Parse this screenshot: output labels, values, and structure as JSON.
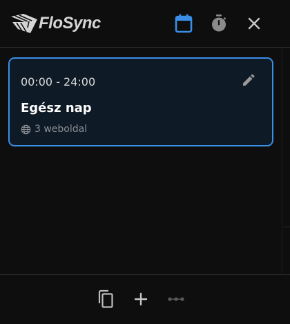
{
  "app": {
    "name": "FloSync"
  },
  "header": {
    "calendar_icon": "calendar-icon",
    "timer_icon": "stopwatch-icon",
    "close_icon": "close-icon"
  },
  "schedule": {
    "items": [
      {
        "time_range": "00:00 - 24:00",
        "title": "Egész nap",
        "sites": "3 weboldal",
        "selected": true
      }
    ]
  },
  "footer": {
    "copy_icon": "copy-icon",
    "add_icon": "plus-icon",
    "more_icon": "more-dots-icon"
  },
  "colors": {
    "accent": "#3a8ee6",
    "background": "#0e0e0f",
    "card_background": "#0e1a25",
    "muted_text": "#8b8f95",
    "icon_gray": "#8a8a8a"
  }
}
